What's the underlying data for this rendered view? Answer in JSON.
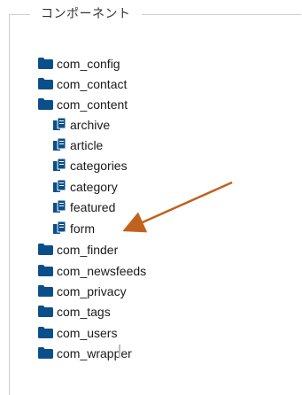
{
  "panel": {
    "legend": "コンポーネント"
  },
  "tree": {
    "items": [
      {
        "label": "com_config",
        "icon": "folder-icon"
      },
      {
        "label": "com_contact",
        "icon": "folder-icon"
      },
      {
        "label": "com_content",
        "icon": "folder-icon"
      },
      {
        "label": "archive",
        "icon": "views-icon"
      },
      {
        "label": "article",
        "icon": "views-icon"
      },
      {
        "label": "categories",
        "icon": "views-icon"
      },
      {
        "label": "category",
        "icon": "views-icon"
      },
      {
        "label": "featured",
        "icon": "views-icon"
      },
      {
        "label": "form",
        "icon": "views-icon"
      },
      {
        "label": "com_finder",
        "icon": "folder-icon"
      },
      {
        "label": "com_newsfeeds",
        "icon": "folder-icon"
      },
      {
        "label": "com_privacy",
        "icon": "folder-icon"
      },
      {
        "label": "com_tags",
        "icon": "folder-icon"
      },
      {
        "label": "com_users",
        "icon": "folder-icon"
      },
      {
        "label": "com_wrapper",
        "icon": "folder-icon"
      }
    ]
  },
  "colors": {
    "icon": "#0b4f8a",
    "arrow": "#c0621e",
    "border": "#cfcfcf"
  }
}
